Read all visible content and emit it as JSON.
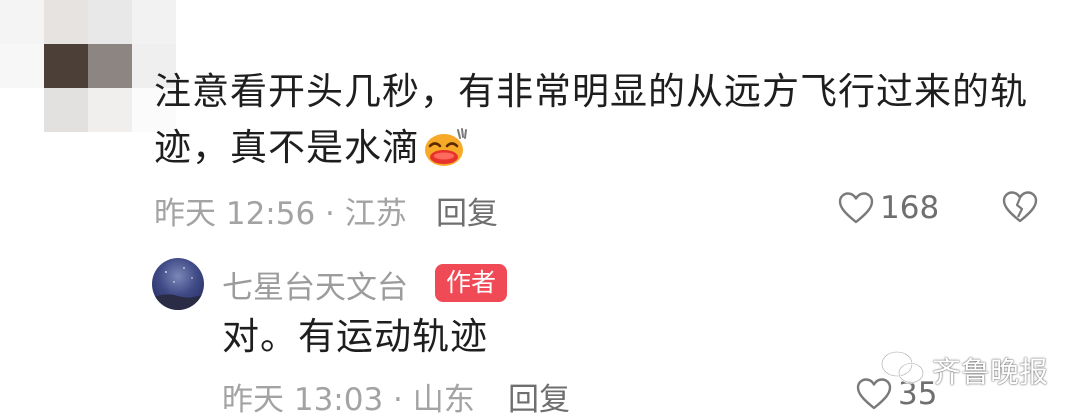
{
  "comment": {
    "avatar_icon": "pixelated-avatar",
    "text_line1": "注意看开头几秒，有非常明显的从远方飞行过来的轨",
    "text_line2": "迹，真不是水滴",
    "emoji": "laughing-face-emoji",
    "time_location": "昨天 12:56 · 江苏",
    "reply_label": "回复",
    "like_count": "168",
    "like_icon": "heart-outline-icon",
    "dislike_icon": "broken-heart-icon"
  },
  "reply": {
    "author": "七星台天文台",
    "badge": "作者",
    "badge_color": "#f04a56",
    "text": "对。有运动轨迹",
    "time_location": "昨天 13:03 · 山东",
    "reply_label": "回复",
    "like_count": "35",
    "like_icon": "heart-outline-icon"
  },
  "watermark": {
    "text": "齐鲁晚报",
    "icon": "wechat-icon"
  },
  "colors": {
    "meta_gray": "#a3a3a3",
    "action_gray": "#6f6f6f",
    "text_dark": "#1e1e1e"
  }
}
